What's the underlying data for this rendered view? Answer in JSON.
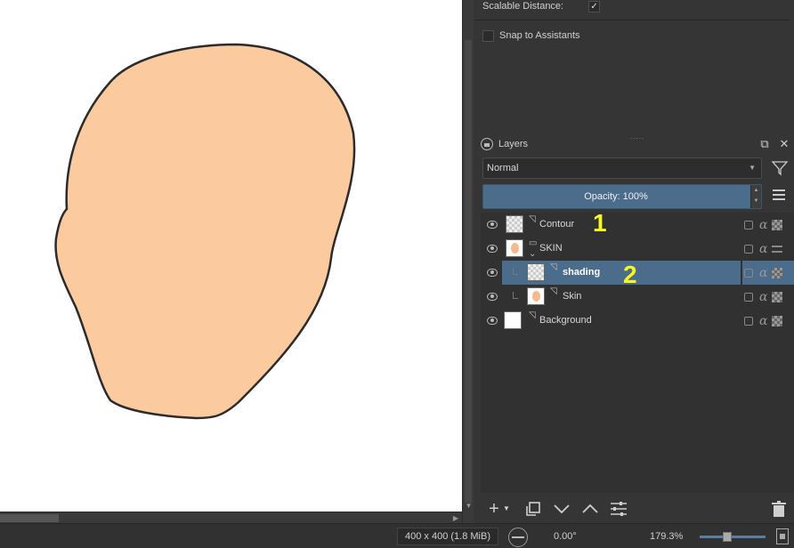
{
  "tool_options": {
    "scalable_distance_label": "Scalable Distance:",
    "scalable_distance_checked": true,
    "snap_to_assistants_label": "Snap to Assistants",
    "snap_to_assistants_checked": false
  },
  "layers_docker": {
    "title": "Layers",
    "blend_mode": "Normal",
    "opacity_label": "Opacity:  100%",
    "opacity_value": 100,
    "layers": [
      {
        "name": "Contour",
        "type": "paint",
        "indent": 0,
        "selected": false,
        "annotation": "1"
      },
      {
        "name": "SKIN",
        "type": "group",
        "indent": 0,
        "selected": false,
        "expanded": true
      },
      {
        "name": "shading",
        "type": "paint",
        "indent": 1,
        "selected": true,
        "annotation": "2"
      },
      {
        "name": "Skin",
        "type": "paint",
        "indent": 1,
        "selected": false
      },
      {
        "name": "Background",
        "type": "paint",
        "indent": 0,
        "selected": false
      }
    ],
    "toolbar_icons": [
      "add-layer-icon",
      "dropdown-icon",
      "duplicate-layer-icon",
      "move-down-icon",
      "move-up-icon",
      "layer-properties-icon",
      "delete-layer-icon"
    ]
  },
  "statusbar": {
    "image_size": "400 x 400 (1.8 MiB)",
    "rotation": "0.00°",
    "zoom": "179.3%"
  },
  "canvas": {
    "skin_color": "#fcca9f",
    "outline_color": "#2b2b2b"
  },
  "colors": {
    "selection": "#4c6c8c",
    "panel": "#353535",
    "annotation": "#f7f722"
  }
}
